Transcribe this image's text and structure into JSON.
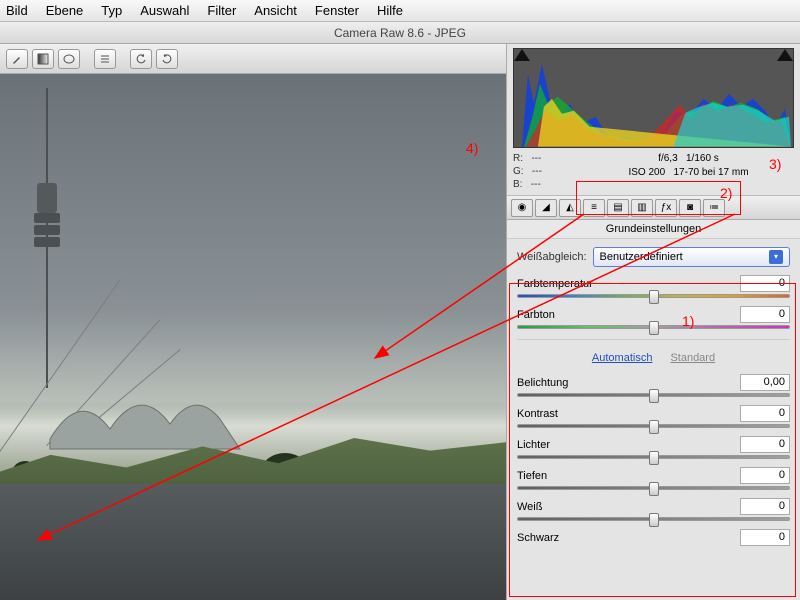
{
  "menu": [
    "Bild",
    "Ebene",
    "Typ",
    "Auswahl",
    "Filter",
    "Ansicht",
    "Fenster",
    "Hilfe"
  ],
  "title": "Camera Raw 8.6 - JPEG",
  "rgb": {
    "r": "R:",
    "g": "G:",
    "b": "B:",
    "dash": "---"
  },
  "exif": {
    "line1_a": "f/6,3",
    "line1_b": "1/160 s",
    "line2_a": "ISO 200",
    "line2_b": "17-70 bei 17 mm"
  },
  "panel_title": "Grundeinstellungen",
  "wb_label": "Weißabgleich:",
  "wb_value": "Benutzerdefiniert",
  "sliders": {
    "temp": {
      "label": "Farbtemperatur",
      "value": "0",
      "pos": 50,
      "cls": "t-temp"
    },
    "tint": {
      "label": "Farbton",
      "value": "0",
      "pos": 50,
      "cls": "t-tint"
    },
    "exposure": {
      "label": "Belichtung",
      "value": "0,00",
      "pos": 50,
      "cls": "t-gray"
    },
    "contrast": {
      "label": "Kontrast",
      "value": "0",
      "pos": 50,
      "cls": "t-gray"
    },
    "highlights": {
      "label": "Lichter",
      "value": "0",
      "pos": 50,
      "cls": "t-gray"
    },
    "shadows": {
      "label": "Tiefen",
      "value": "0",
      "pos": 50,
      "cls": "t-gray"
    },
    "whites": {
      "label": "Weiß",
      "value": "0",
      "pos": 50,
      "cls": "t-gray"
    },
    "blacks": {
      "label": "Schwarz",
      "value": "0",
      "pos": 50,
      "cls": "t-gray"
    }
  },
  "auto": "Automatisch",
  "standard": "Standard",
  "annotations": {
    "a1": "1)",
    "a2": "2)",
    "a3": "3)",
    "a4": "4)"
  }
}
